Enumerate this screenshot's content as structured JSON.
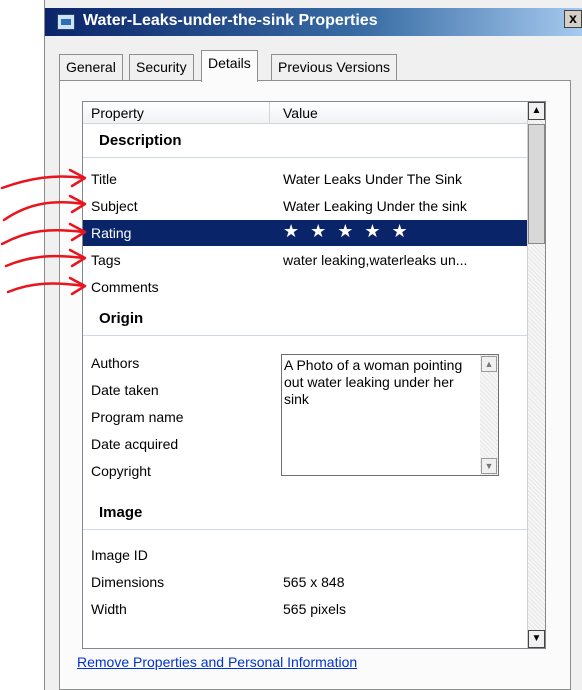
{
  "window": {
    "title": "Water-Leaks-under-the-sink Properties",
    "close_label": "x"
  },
  "tabs": [
    {
      "label": "General"
    },
    {
      "label": "Security"
    },
    {
      "label": "Details",
      "active": true
    },
    {
      "label": "Previous Versions"
    }
  ],
  "grid": {
    "columns": [
      "Property",
      "Value"
    ],
    "sections": [
      {
        "name": "Description",
        "rows": [
          {
            "property": "Title",
            "value": "Water Leaks Under The Sink"
          },
          {
            "property": "Subject",
            "value": "Water Leaking Under the sink"
          },
          {
            "property": "Rating",
            "value": "★ ★ ★ ★ ★",
            "selected": true,
            "stars": 5
          },
          {
            "property": "Tags",
            "value": "water leaking,waterleaks un..."
          },
          {
            "property": "Comments",
            "value": "A Photo of a woman pointing out water leaking under her sink"
          }
        ]
      },
      {
        "name": "Origin",
        "rows": [
          {
            "property": "Authors",
            "value": ""
          },
          {
            "property": "Date taken",
            "value": ""
          },
          {
            "property": "Program name",
            "value": ""
          },
          {
            "property": "Date acquired",
            "value": ""
          },
          {
            "property": "Copyright",
            "value": ""
          }
        ]
      },
      {
        "name": "Image",
        "rows": [
          {
            "property": "Image ID",
            "value": ""
          },
          {
            "property": "Dimensions",
            "value": "565 x 848"
          },
          {
            "property": "Width",
            "value": "565 pixels"
          }
        ]
      }
    ]
  },
  "footer": {
    "remove_link": "Remove Properties and Personal Information"
  },
  "colors": {
    "selection": "#0a246a",
    "titlebar": "#0a246a",
    "annotation_arrows": "#e8141e",
    "link": "#0033cc"
  },
  "icons": {
    "title_icon": "image-file-icon",
    "scroll_up": "arrow-up-icon",
    "scroll_down": "arrow-down-icon"
  }
}
